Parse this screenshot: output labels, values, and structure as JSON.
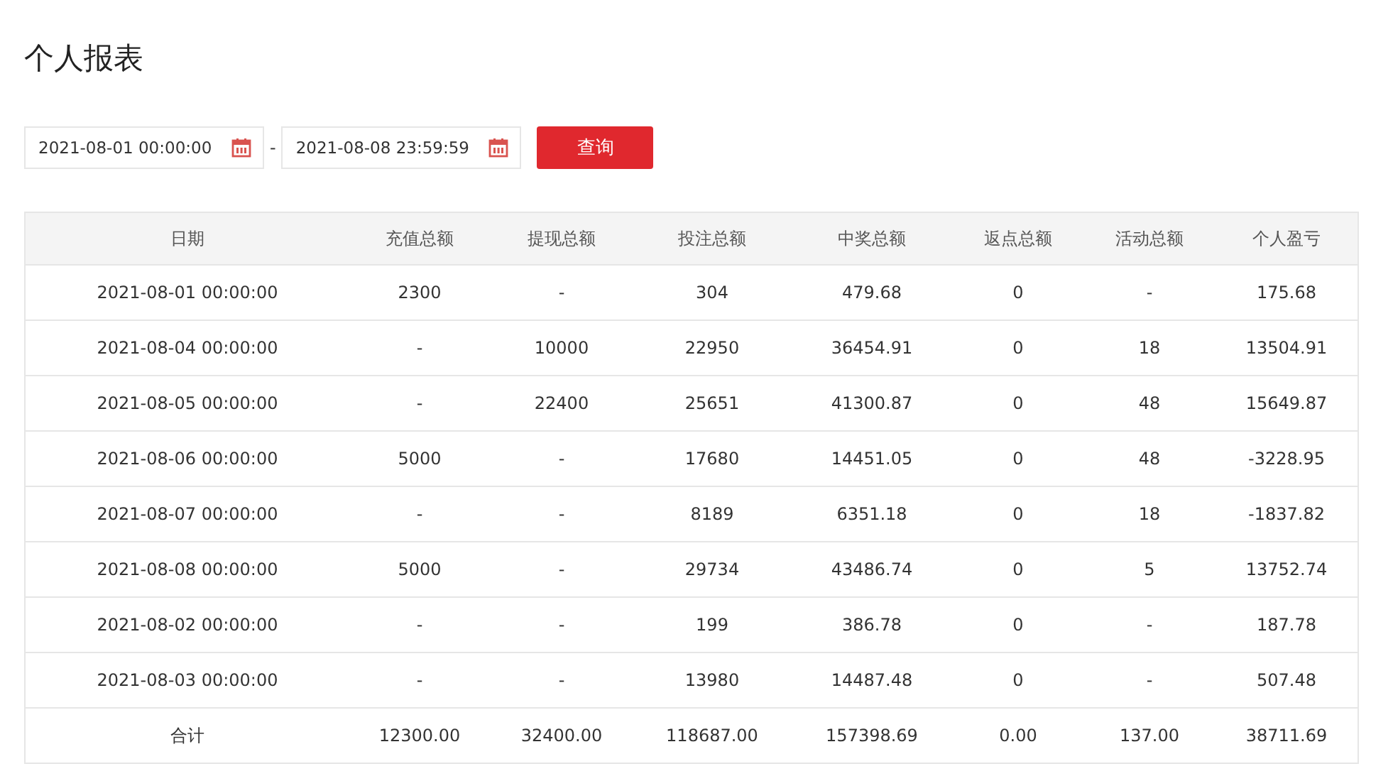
{
  "title": "个人报表",
  "filter": {
    "start": "2021-08-01 00:00:00",
    "separator": "-",
    "end": "2021-08-08 23:59:59",
    "button": "查询"
  },
  "table": {
    "columns": [
      "日期",
      "充值总额",
      "提现总额",
      "投注总额",
      "中奖总额",
      "返点总额",
      "活动总额",
      "个人盈亏"
    ],
    "rows": [
      [
        "2021-08-01 00:00:00",
        "2300",
        "-",
        "304",
        "479.68",
        "0",
        "-",
        "175.68"
      ],
      [
        "2021-08-04 00:00:00",
        "-",
        "10000",
        "22950",
        "36454.91",
        "0",
        "18",
        "13504.91"
      ],
      [
        "2021-08-05 00:00:00",
        "-",
        "22400",
        "25651",
        "41300.87",
        "0",
        "48",
        "15649.87"
      ],
      [
        "2021-08-06 00:00:00",
        "5000",
        "-",
        "17680",
        "14451.05",
        "0",
        "48",
        "-3228.95"
      ],
      [
        "2021-08-07 00:00:00",
        "-",
        "-",
        "8189",
        "6351.18",
        "0",
        "18",
        "-1837.82"
      ],
      [
        "2021-08-08 00:00:00",
        "5000",
        "-",
        "29734",
        "43486.74",
        "0",
        "5",
        "13752.74"
      ],
      [
        "2021-08-02 00:00:00",
        "-",
        "-",
        "199",
        "386.78",
        "0",
        "-",
        "187.78"
      ],
      [
        "2021-08-03 00:00:00",
        "-",
        "-",
        "13980",
        "14487.48",
        "0",
        "-",
        "507.48"
      ]
    ],
    "total": [
      "合计",
      "12300.00",
      "32400.00",
      "118687.00",
      "157398.69",
      "0.00",
      "137.00",
      "38711.69"
    ]
  }
}
